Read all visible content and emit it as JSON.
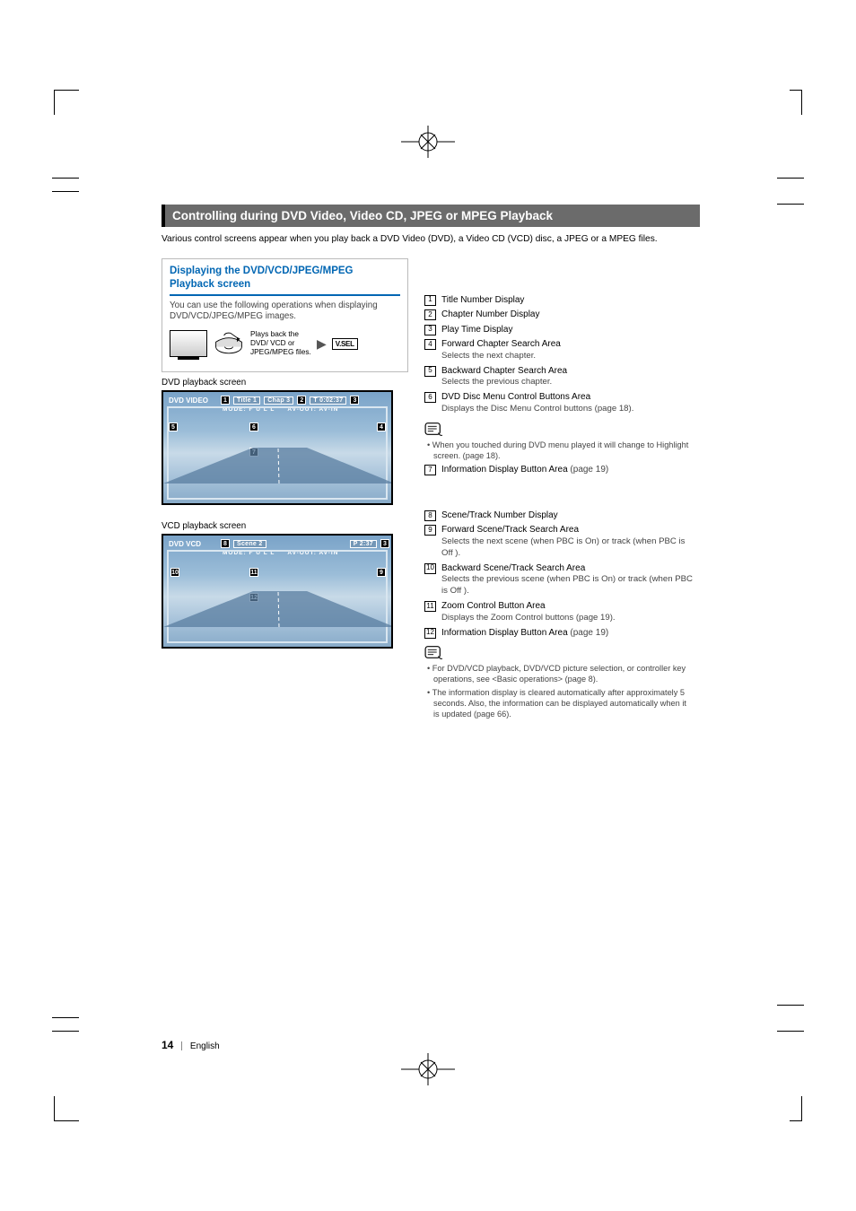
{
  "header": {
    "section_title": "Controlling during DVD Video, Video CD, JPEG or MPEG Playback"
  },
  "intro": "Various control screens appear when you play back a DVD Video (DVD), a Video CD (VCD) disc, a JPEG or a MPEG files.",
  "left": {
    "box_title": "Displaying the DVD/VCD/JPEG/MPEG Playback screen",
    "box_text": "You can use the following operations when displaying DVD/VCD/JPEG/MPEG images.",
    "media_caption": "Plays back the DVD/ VCD or JPEG/MPEG files.",
    "vsel": "V.SEL",
    "dvd_label": "DVD playback screen",
    "vcd_label": "VCD playback screen",
    "dvd_screen": {
      "source": "DVD VIDEO",
      "title": "Title 1",
      "chap": "Chap 3",
      "time": "T   0:02:37",
      "mode": "MODE:  F U L L",
      "avout": "AV-OUT: AV-IN",
      "callouts": {
        "c1": "1",
        "c2": "2",
        "c3": "3",
        "c4": "4",
        "c5": "5",
        "c6": "6",
        "c7": "7"
      }
    },
    "vcd_screen": {
      "source": "DVD VCD",
      "scene": "Scene     2",
      "time": "P    2:37",
      "mode": "MODE:  F U L L",
      "avout": "AV-OUT: AV-IN",
      "callouts": {
        "c8": "8",
        "c3": "3",
        "c9": "9",
        "c10": "10",
        "c11": "11",
        "c12": "12"
      }
    }
  },
  "right": {
    "items1": [
      {
        "n": "1",
        "title": "Title Number Display"
      },
      {
        "n": "2",
        "title": "Chapter Number Display"
      },
      {
        "n": "3",
        "title": "Play Time Display"
      },
      {
        "n": "4",
        "title": "Forward Chapter Search Area",
        "desc": "Selects the next chapter."
      },
      {
        "n": "5",
        "title": "Backward Chapter Search Area",
        "desc": "Selects the previous chapter."
      },
      {
        "n": "6",
        "title": "DVD Disc Menu Control Buttons Area",
        "desc": "Displays the Disc Menu Control buttons (page 18)."
      }
    ],
    "note1": "When you touched during DVD menu played it will change to Highlight screen. (page 18).",
    "item7": {
      "n": "7",
      "title": "Information Display Button Area",
      "ref": "(page 19)"
    },
    "items2": [
      {
        "n": "8",
        "title": "Scene/Track Number Display"
      },
      {
        "n": "9",
        "title": "Forward Scene/Track Search Area",
        "desc": "Selects the next scene (when PBC is On) or track (when PBC is Off )."
      },
      {
        "n": "10",
        "title": "Backward Scene/Track Search Area",
        "desc": "Selects the previous scene (when PBC is On) or track (when PBC is Off )."
      },
      {
        "n": "11",
        "title": "Zoom Control Button Area",
        "desc": "Displays the Zoom Control buttons (page 19)."
      },
      {
        "n": "12",
        "title": "Information Display Button Area",
        "ref": "(page 19)"
      }
    ],
    "notes2": [
      "For DVD/VCD playback, DVD/VCD picture selection, or controller key operations, see <Basic operations> (page 8).",
      "The information display is cleared automatically after approximately 5 seconds. Also, the information can be displayed automatically when it is updated (page 66)."
    ]
  },
  "footer": {
    "page": "14",
    "lang": "English"
  }
}
